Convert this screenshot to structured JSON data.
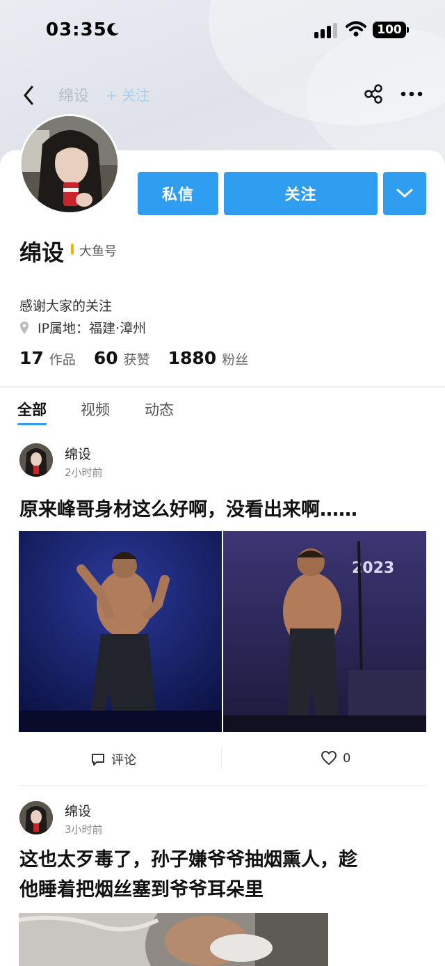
{
  "status_bar": {
    "time": "03:35",
    "battery": "100"
  },
  "nav": {
    "name": "绵设",
    "follow": "+ 关注"
  },
  "profile": {
    "name": "绵设",
    "badge": "大鱼号",
    "bio": "感谢大家的关注",
    "location": "IP属地：福建·漳州",
    "stats": [
      {
        "num": "17",
        "label": "作品"
      },
      {
        "num": "60",
        "label": "获赞"
      },
      {
        "num": "1880",
        "label": "粉丝"
      }
    ]
  },
  "actions": {
    "message": "私信",
    "follow": "关注"
  },
  "tabs": [
    {
      "label": "全部",
      "active": true
    },
    {
      "label": "视频",
      "active": false
    },
    {
      "label": "动态",
      "active": false
    }
  ],
  "posts": [
    {
      "author": "绵设",
      "time": "2小时前",
      "title": "原来峰哥身材这么好啊，没看出来啊……",
      "image_labels": [
        "2023"
      ],
      "comment_label": "评论",
      "like_count": "0"
    },
    {
      "author": "绵设",
      "time": "3小时前",
      "title_lines": [
        "这也太歹毒了，孙子嫌爷爷抽烟熏人，趁",
        "他睡着把烟丝塞到爷爷耳朵里"
      ]
    }
  ],
  "colors": {
    "accent": "#2f9df0",
    "badge": "#f5b400"
  }
}
